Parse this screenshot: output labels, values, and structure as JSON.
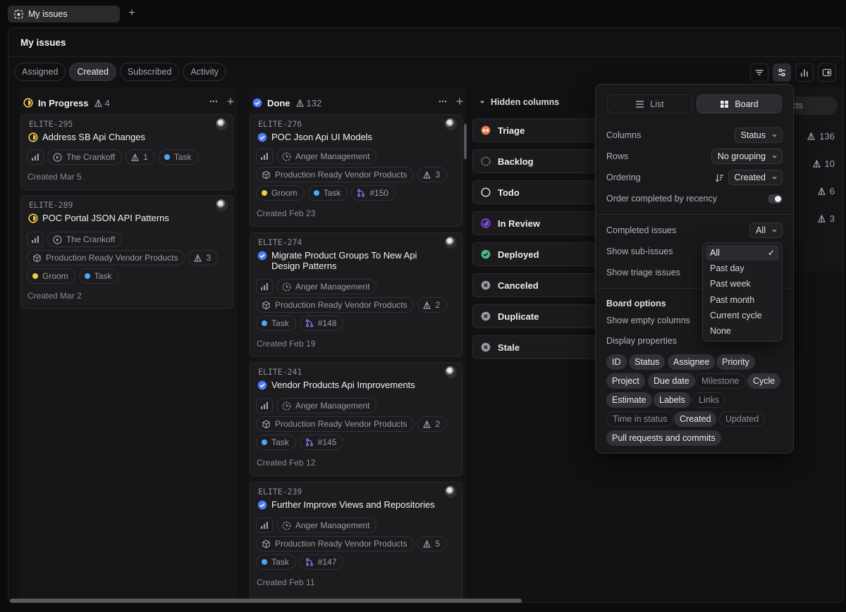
{
  "tab": {
    "title": "My issues",
    "new_tab_symbol": "+"
  },
  "page": {
    "title": "My issues"
  },
  "view_tabs": [
    "Assigned",
    "Created",
    "Subscribed",
    "Activity"
  ],
  "active_view_tab": "Created",
  "toolbar": {
    "icons": [
      "filter-icon",
      "display-options-icon",
      "insights-icon",
      "sidebar-toggle-icon"
    ]
  },
  "columns": [
    {
      "name": "In Progress",
      "count": "4",
      "status_color": "#f2c94c",
      "cards": [
        {
          "id": "ELITE-295",
          "title": "Address SB Api Changes",
          "rows": [
            [
              "The Crankoff",
              "1",
              "Task"
            ]
          ],
          "created": "Created Mar 5"
        },
        {
          "id": "ELITE-289",
          "title": "POC Portal JSON API Patterns",
          "rows": [
            [
              "The Crankoff"
            ],
            [
              "Production Ready Vendor Products",
              "3"
            ],
            [
              "Groom",
              "Task"
            ]
          ],
          "created": "Created Mar 2"
        }
      ]
    },
    {
      "name": "Done",
      "count": "132",
      "status_color": "#4c7df0",
      "cards": [
        {
          "id": "ELITE-276",
          "title": "POC Json Api UI Models",
          "project": "Anger Management",
          "milestone": "Production Ready Vendor Products",
          "estimate": "3",
          "labels": [
            "Groom",
            "Task"
          ],
          "pr": "#150",
          "created": "Created Feb 23"
        },
        {
          "id": "ELITE-274",
          "title": "Migrate Product Groups To New Api Design Patterns",
          "project": "Anger Management",
          "milestone": "Production Ready Vendor Products",
          "estimate": "2",
          "labels": [
            "Task"
          ],
          "pr": "#148",
          "created": "Created Feb 19"
        },
        {
          "id": "ELITE-241",
          "title": "Vendor Products Api Improvements",
          "project": "Anger Management",
          "milestone": "Production Ready Vendor Products",
          "estimate": "2",
          "labels": [
            "Task"
          ],
          "pr": "#145",
          "created": "Created Feb 12"
        },
        {
          "id": "ELITE-239",
          "title": "Further Improve Views and Repositories",
          "project": "Anger Management",
          "milestone": "Production Ready Vendor Products",
          "estimate": "5",
          "labels": [
            "Task"
          ],
          "pr": "#147",
          "created": "Created Feb 11"
        }
      ]
    }
  ],
  "hidden_columns": {
    "label": "Hidden columns",
    "items": [
      "Triage",
      "Backlog",
      "Todo",
      "In Review",
      "Deployed",
      "Canceled",
      "Duplicate",
      "Stale"
    ]
  },
  "behind_panel": {
    "button": "ects",
    "stats": [
      "136",
      "10",
      "6",
      "3"
    ]
  },
  "display_panel": {
    "layout_options": [
      "List",
      "Board"
    ],
    "active_layout": "Board",
    "columns_label": "Columns",
    "columns_value": "Status",
    "rows_label": "Rows",
    "rows_value": "No grouping",
    "ordering_label": "Ordering",
    "ordering_value": "Created",
    "order_completed_label": "Order completed by recency",
    "completed_label": "Completed issues",
    "completed_value": "All",
    "subissues_label": "Show sub-issues",
    "triage_label": "Show triage issues",
    "board_options_label": "Board options",
    "empty_columns_label": "Show empty columns",
    "display_props_label": "Display properties",
    "properties": [
      {
        "label": "ID",
        "on": true
      },
      {
        "label": "Status",
        "on": true
      },
      {
        "label": "Assignee",
        "on": true
      },
      {
        "label": "Priority",
        "on": true
      },
      {
        "label": "Project",
        "on": true
      },
      {
        "label": "Due date",
        "on": true
      },
      {
        "label": "Milestone",
        "on": false
      },
      {
        "label": "Cycle",
        "on": true
      },
      {
        "label": "Estimate",
        "on": true
      },
      {
        "label": "Labels",
        "on": true
      },
      {
        "label": "Links",
        "on": false
      },
      {
        "label": "Time in status",
        "on": false
      },
      {
        "label": "Created",
        "on": true
      },
      {
        "label": "Updated",
        "on": false
      },
      {
        "label": "Pull requests and commits",
        "on": true
      }
    ]
  },
  "completed_menu": {
    "options": [
      "All",
      "Past day",
      "Past week",
      "Past month",
      "Current cycle",
      "None"
    ],
    "selected": "All",
    "check_mark": "✓"
  },
  "colors": {
    "label_yellow": "#f2c94c",
    "label_blue": "#4ea7f5",
    "pr_purple": "#8b7cf6",
    "triage_orange": "#f07a4c",
    "review_purple": "#8a4cf0",
    "deployed_green": "#4cb782"
  }
}
